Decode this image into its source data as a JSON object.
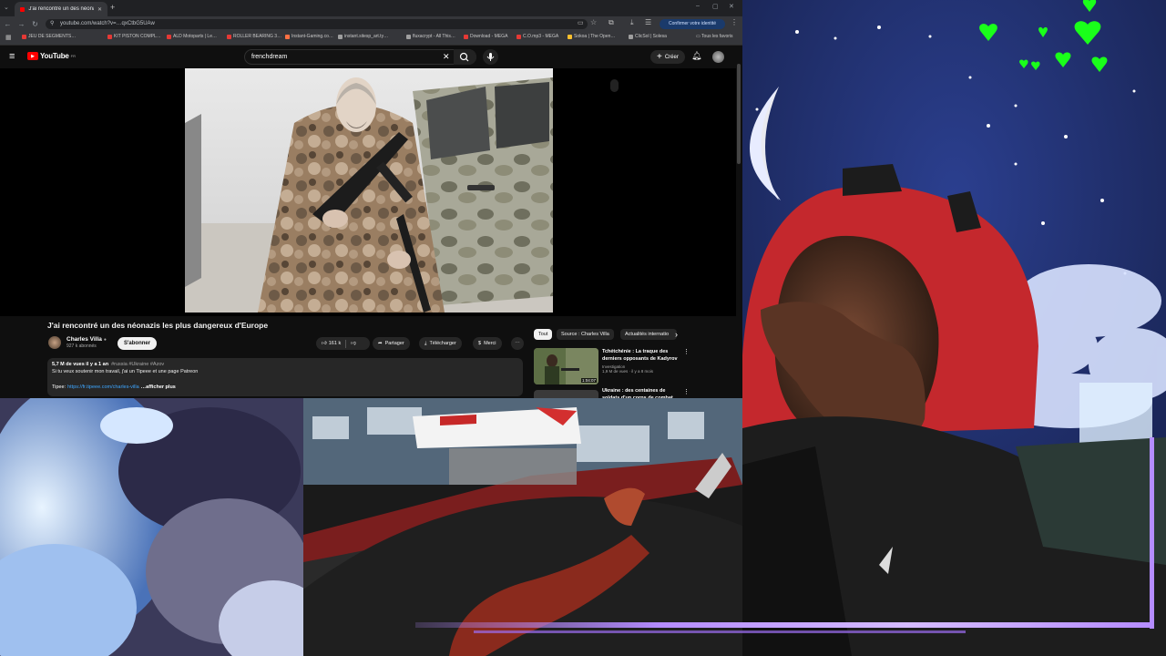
{
  "browser": {
    "tab_title": "J'ai rencontré un des néona…",
    "url": "youtube.com/watch?v=…qxCtbG5UAw",
    "profile_label": "Confirmer votre identité",
    "bookmarks": [
      {
        "label": "JEU DE SEGMENTS…",
        "color": "#e53935"
      },
      {
        "label": "KIT PISTON COMPL…",
        "color": "#e53935"
      },
      {
        "label": "ALD Motoparts | Le…",
        "color": "#e53935"
      },
      {
        "label": "ROLLER BEARING 3…",
        "color": "#e53935"
      },
      {
        "label": "Instant-Gaming.co…",
        "color": "#ff7043"
      },
      {
        "label": "instant.sitesp_art.ty…",
        "color": "#9e9e9e"
      },
      {
        "label": "fluxacrypt - All This…",
        "color": "#9e9e9e"
      },
      {
        "label": "Download - MEGA",
        "color": "#e53935"
      },
      {
        "label": "C.O.mp3 - MEGA",
        "color": "#e53935"
      },
      {
        "label": "Sokoa | The Open…",
        "color": "#fbc02d"
      },
      {
        "label": "ClicSol | Solesa",
        "color": "#9e9e9e"
      }
    ],
    "all_bookmarks": "Tous les favoris"
  },
  "youtube": {
    "logo": "YouTube",
    "logo_sup": "FR",
    "search_value": "frenchdream",
    "create_label": "Créer",
    "video_title": "J'ai rencontré un des néonazis les plus dangereux d'Europe",
    "channel_name": "Charles Villa",
    "subscribers": "927 k abonnés",
    "subscribe_label": "S'abonner",
    "likes": "161 k",
    "share_label": "Partager",
    "download_label": "Télécharger",
    "thanks_label": "Merci",
    "desc_stats": "5,7 M de vues  il y a 1 an",
    "desc_tags": "#russia #Ukraine #Azov",
    "desc_line": "Si tu veux soutenir mon travail, j'ai un Tipeee et une page Patreon",
    "desc_tipee_label": "Tipee:",
    "desc_link": "https://fr.tipeee.com/charles-villa",
    "show_more": "…afficher plus",
    "chips": [
      "Tout",
      "Source : Charles Villa",
      "Actualités internatio"
    ],
    "recommendations": [
      {
        "title": "Tchétchénie : La traque des derniers opposants de Kadyrov",
        "channel": "Investigation",
        "meta": "1,9 M de vues · il y a 8 mois",
        "duration": "1:04:07"
      },
      {
        "title": "Ukraine : des centaines de soldats d'un corps de combat…",
        "channel": "",
        "meta": "",
        "duration": ""
      }
    ]
  },
  "colors": {
    "yt_red": "#ff0000",
    "chrome_bg": "#202124",
    "heart_green": "#1aff1a",
    "glitch_purple": "#b58cff"
  }
}
